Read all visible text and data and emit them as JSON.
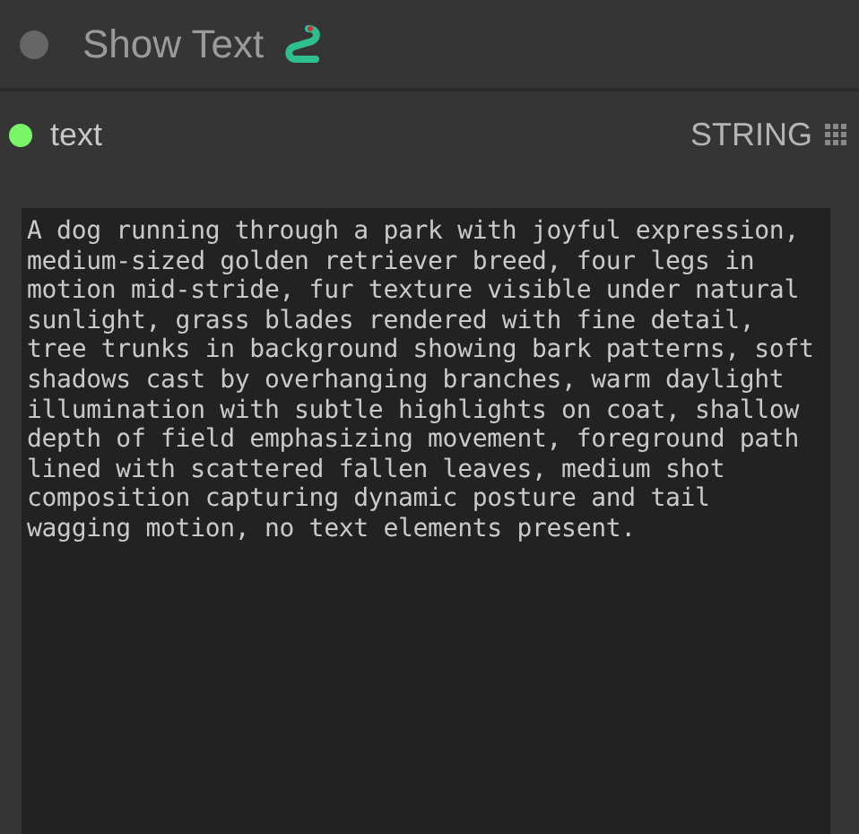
{
  "node": {
    "title": "Show Text"
  },
  "slot": {
    "name": "text",
    "type": "STRING",
    "color": "#7af56a"
  },
  "text_area": {
    "value": "A dog running through a park with joyful expression, medium-sized golden retriever breed, four legs in motion mid-stride, fur texture visible under natural sunlight, grass blades rendered with fine detail, tree trunks in background showing bark patterns, soft shadows cast by overhanging branches, warm daylight illumination with subtle highlights on coat, shallow depth of field emphasizing movement, foreground path lined with scattered fallen leaves, medium shot composition capturing dynamic posture and tail wagging motion, no text elements present."
  }
}
